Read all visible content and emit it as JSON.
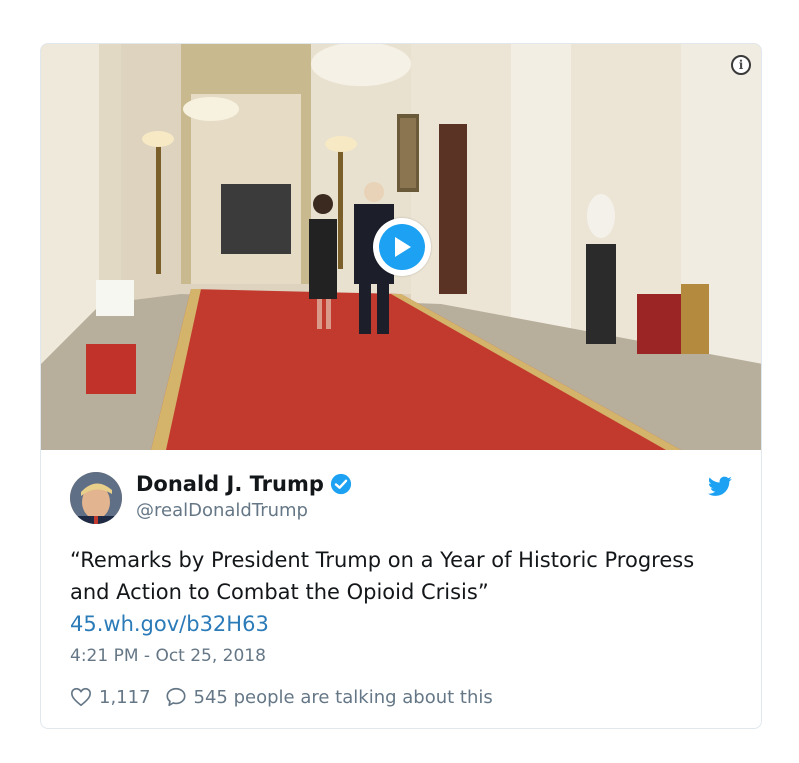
{
  "tweet": {
    "author_name": "Donald J. Trump",
    "handle": "@realDonaldTrump",
    "text": "“Remarks by President Trump on a Year of Historic Progress and Action to Combat the Opioid Crisis”",
    "link": "45.wh.gov/b32H63",
    "timestamp": "4:21 PM - Oct 25, 2018",
    "likes": "1,117",
    "replies_text": "545 people are talking about this"
  },
  "icons": {
    "info": "info-icon",
    "play": "play-icon",
    "verified": "verified-badge-icon",
    "twitter": "twitter-bird-icon",
    "like": "heart-icon",
    "reply": "speech-bubble-icon"
  },
  "colors": {
    "accent": "#1da1f2",
    "link": "#2b7bb9",
    "muted": "#657786",
    "text": "#14171a",
    "carpet": "#c23a2e"
  }
}
